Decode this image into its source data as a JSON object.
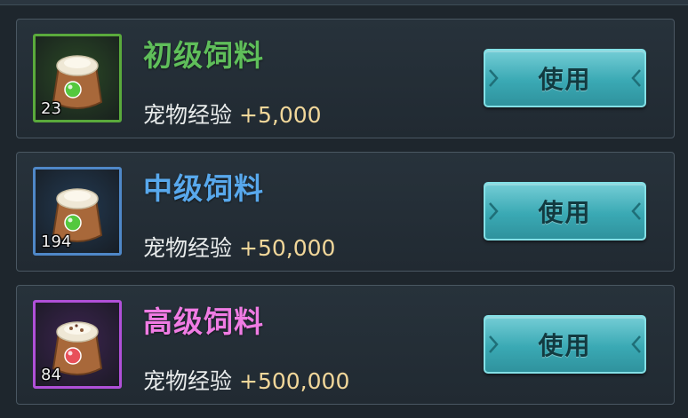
{
  "exp_label": "宠物经验",
  "button_label": "使用",
  "colors": {
    "button_fill": "#3aa9b4",
    "exp_value": "#f1d79a"
  },
  "items": [
    {
      "name": "初级饲料",
      "count": "23",
      "exp_value": "+5,000",
      "name_color": "#5fbe5a",
      "frame_color": "#5aaa3c",
      "bg_color": "#2b4a26",
      "charm_color": "#54c83e",
      "icon": "feed-bag-icon"
    },
    {
      "name": "中级饲料",
      "count": "194",
      "exp_value": "+50,000",
      "name_color": "#58a8ec",
      "frame_color": "#4f88c8",
      "bg_color": "#233a52",
      "charm_color": "#54c83e",
      "icon": "feed-bag-icon"
    },
    {
      "name": "高级饲料",
      "count": "84",
      "exp_value": "+500,000",
      "name_color": "#f07ce4",
      "frame_color": "#b050d8",
      "bg_color": "#3c2450",
      "charm_color": "#e8505a",
      "icon": "feed-bag-icon"
    }
  ]
}
